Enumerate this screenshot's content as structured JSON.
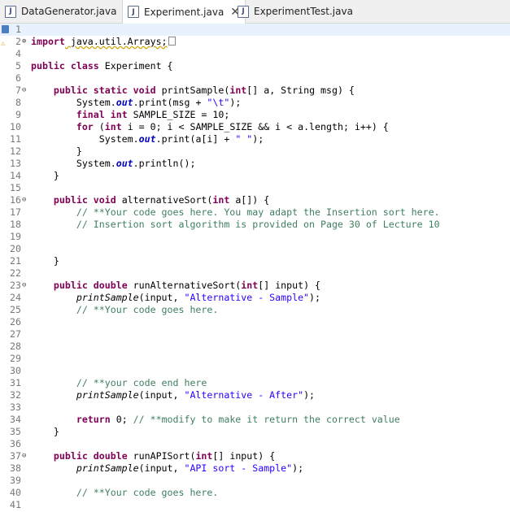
{
  "tabs": [
    {
      "label": "DataGenerator.java"
    },
    {
      "label": "Experiment.java"
    },
    {
      "label": "ExperimentTest.java"
    }
  ],
  "editor": {
    "lines": [
      {
        "n": "1"
      },
      {
        "n": "2"
      },
      {
        "n": "4"
      },
      {
        "n": "5"
      },
      {
        "n": "6"
      },
      {
        "n": "7"
      },
      {
        "n": "8"
      },
      {
        "n": "9"
      },
      {
        "n": "10"
      },
      {
        "n": "11"
      },
      {
        "n": "12"
      },
      {
        "n": "13"
      },
      {
        "n": "14"
      },
      {
        "n": "15"
      },
      {
        "n": "16"
      },
      {
        "n": "17"
      },
      {
        "n": "18"
      },
      {
        "n": "19"
      },
      {
        "n": "20"
      },
      {
        "n": "21"
      },
      {
        "n": "22"
      },
      {
        "n": "23"
      },
      {
        "n": "24"
      },
      {
        "n": "25"
      },
      {
        "n": "26"
      },
      {
        "n": "27"
      },
      {
        "n": "28"
      },
      {
        "n": "29"
      },
      {
        "n": "30"
      },
      {
        "n": "31"
      },
      {
        "n": "32"
      },
      {
        "n": "33"
      },
      {
        "n": "34"
      },
      {
        "n": "35"
      },
      {
        "n": "36"
      },
      {
        "n": "37"
      },
      {
        "n": "38"
      },
      {
        "n": "39"
      },
      {
        "n": "40"
      },
      {
        "n": "41"
      }
    ],
    "t": {
      "import_kw": "import",
      "import_pkg": " java.util.Arrays;",
      "public": "public",
      "class": "class",
      "class_name": " Experiment {",
      "static": "static",
      "void": "void",
      "int": "int",
      "final": "final",
      "for": "for",
      "double": "double",
      "return": "return",
      "sig_print": " printSample(",
      "sig_print2": "[] a, String msg) {",
      "sys": "System.",
      "out": "out",
      "print_msg": ".print(msg + ",
      "tab_str": "\"\\t\"",
      "close_stmt": ");",
      "sample_decl": " SAMPLE_SIZE = 10;",
      "for_a": " (",
      "for_b": " i = 0; i < SAMPLE_SIZE && i < a.length; i++) {",
      "print_ai": ".print(a[i] + ",
      "space_str": "\" \"",
      "brace_close": "}",
      "println": ".println();",
      "alt_sig": " alternativeSort(",
      "alt_sig2": " a[]) {",
      "c17": "// **Your code goes here. You may adapt the Insertion sort here.",
      "c18": "// Insertion sort algorithm is provided on Page 30 of Lecture 10",
      "run_alt_sig": " runAlternativeSort(",
      "input_sig": "[] input) {",
      "print_sample": "printSample",
      "input_arg": "(input, ",
      "alt_sample": "\"Alternative - Sample\"",
      "c25": "// **Your code goes here.",
      "c31": "// **your code end here",
      "alt_after": "\"Alternative - After\"",
      "ret_zero": " 0; ",
      "c34": "// **modify to make it return the correct value",
      "run_api_sig": " runAPISort(",
      "api_sample": "\"API sort - Sample\"",
      "c40": "// **Your code goes here."
    }
  }
}
